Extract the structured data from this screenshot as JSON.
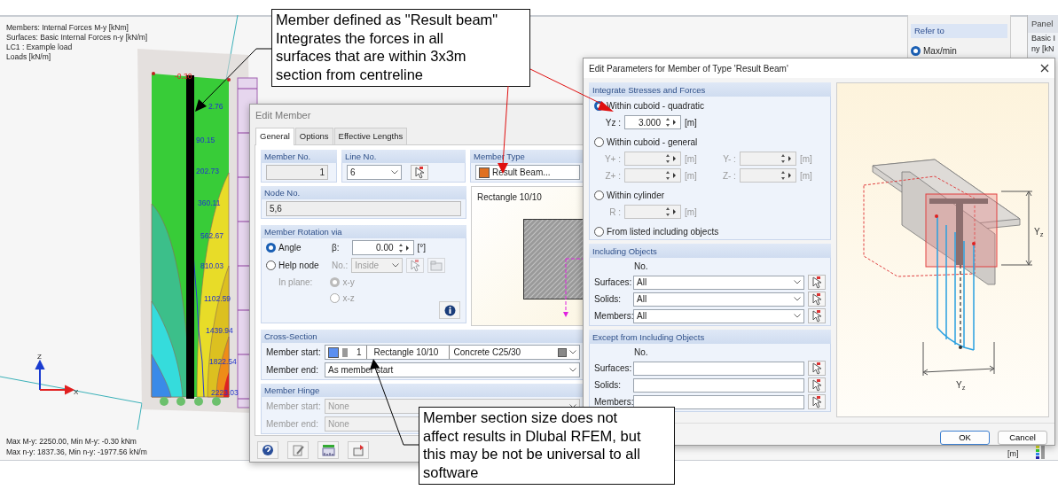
{
  "viewport": {
    "info_lines": [
      "Members: Internal Forces M-y [kNm]",
      "Surfaces: Basic Internal Forces n-y [kN/m]",
      "LC1 : Example load",
      "Loads [kN/m]"
    ],
    "contour_labels": [
      {
        "text": "-0.30",
        "kind": "min"
      },
      {
        "text": "2.76",
        "kind": "value"
      },
      {
        "text": "90.15",
        "kind": "value"
      },
      {
        "text": "202.73",
        "kind": "value"
      },
      {
        "text": "360.11",
        "kind": "value"
      },
      {
        "text": "562.67",
        "kind": "value"
      },
      {
        "text": "810.03",
        "kind": "value"
      },
      {
        "text": "1102.59",
        "kind": "value"
      },
      {
        "text": "1439.94",
        "kind": "value"
      },
      {
        "text": "1822.54",
        "kind": "value"
      },
      {
        "text": "2223.03",
        "kind": "value"
      }
    ],
    "axis_labels": [
      "Z",
      "X"
    ],
    "summary_lines": [
      "Max M-y: 2250.00, Min M-y: -0.30 kNm",
      "Max n-y: 1837.36, Min n-y: -1977.56 kN/m"
    ],
    "unit": "[m]"
  },
  "options_panel": {
    "section": "Refer to",
    "choices": [
      {
        "label": "Max/min",
        "selected": true
      }
    ]
  },
  "side_panel": {
    "title": "Panel",
    "lines": [
      "Basic I",
      "ny [kN"
    ]
  },
  "edit_member": {
    "title": "Edit Member",
    "tabs": [
      {
        "label": "General",
        "selected": true
      },
      {
        "label": "Options",
        "selected": false
      },
      {
        "label": "Effective Lengths",
        "selected": false
      }
    ],
    "member_no": {
      "label": "Member No.",
      "value": "1"
    },
    "line_no": {
      "label": "Line No.",
      "value": "6"
    },
    "member_type": {
      "label": "Member Type",
      "value": "Result Beam..."
    },
    "node_no": {
      "label": "Node No.",
      "value": "5,6"
    },
    "preview": {
      "title": "Rectangle 10/10"
    },
    "rotation": {
      "title": "Member Rotation via",
      "options": [
        {
          "label": "Angle",
          "selected": true
        },
        {
          "label": "Help node",
          "selected": false
        }
      ],
      "beta_label": "β:",
      "beta_value": "0.00",
      "beta_unit": "[°]",
      "no_label": "No.:",
      "no_value": "Inside",
      "plane_label": "In plane:",
      "plane_options": [
        {
          "label": "x-y",
          "selected": true
        },
        {
          "label": "x-z",
          "selected": false
        }
      ]
    },
    "cross_section": {
      "title": "Cross-Section",
      "start_label": "Member start:",
      "start_no": "1",
      "start_name": "Rectangle 10/10",
      "start_material": "Concrete C25/30",
      "end_label": "Member end:",
      "end_value": "As member start"
    },
    "hinge": {
      "title": "Member Hinge",
      "disabled": true,
      "start_label": "Member start:",
      "start_value": "None",
      "end_label": "Member end:",
      "end_value": "None"
    }
  },
  "result_dialog": {
    "title": "Edit Parameters for Member of Type 'Result Beam'",
    "integrate": {
      "title": "Integrate Stresses and Forces",
      "options": [
        {
          "label": "Within cuboid - quadratic",
          "selected": true,
          "fields": [
            {
              "label": "Yz :",
              "value": "3.000",
              "unit": "[m]",
              "disabled": false
            }
          ]
        },
        {
          "label": "Within cuboid - general",
          "selected": false,
          "fields": [
            {
              "label": "Y+ :",
              "unit": "[m]",
              "disabled": true
            },
            {
              "label": "Y- :",
              "unit": "[m]",
              "disabled": true
            },
            {
              "label": "Z+ :",
              "unit": "[m]",
              "disabled": true
            },
            {
              "label": "Z- :",
              "unit": "[m]",
              "disabled": true
            }
          ]
        },
        {
          "label": "Within cylinder",
          "selected": false,
          "fields": [
            {
              "label": "R :",
              "unit": "[m]",
              "disabled": true
            }
          ]
        },
        {
          "label": "From listed including objects",
          "selected": false
        }
      ]
    },
    "including": {
      "title": "Including Objects",
      "column": "No.",
      "rows": [
        {
          "label": "Surfaces:",
          "value": "All"
        },
        {
          "label": "Solids:",
          "value": "All"
        },
        {
          "label": "Members:",
          "value": "All"
        }
      ]
    },
    "except": {
      "title": "Except from Including Objects",
      "column": "No.",
      "rows": [
        {
          "label": "Surfaces:"
        },
        {
          "label": "Solids:"
        },
        {
          "label": "Members:"
        }
      ]
    },
    "figure_labels": [
      "Y$_{z}$",
      "Y$_{z}$"
    ],
    "buttons": [
      "OK",
      "Cancel"
    ]
  },
  "callouts": [
    {
      "text": "Member defined as \"Result beam\"\nIntegrates the forces in all\nsurfaces that are within 3x3m\nsection from centreline"
    },
    {
      "text": "Member section size does not\naffect results in Dlubal RFEM, but\nthis may be not be universal to all\nsoftware"
    }
  ]
}
